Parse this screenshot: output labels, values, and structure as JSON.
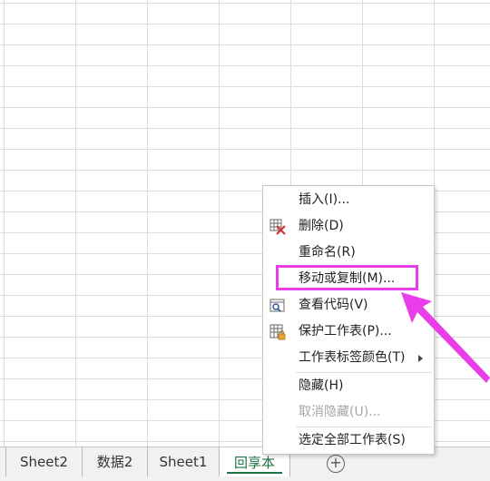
{
  "sheet_tabs": [
    {
      "label": "Sheet2",
      "active": false
    },
    {
      "label": "数据2",
      "active": false
    },
    {
      "label": "Sheet1",
      "active": false
    },
    {
      "label": "回享本",
      "active": true
    }
  ],
  "add_sheet_symbol": "+",
  "context_menu": {
    "items": [
      {
        "label": "插入(I)...",
        "icon": "none",
        "enabled": true
      },
      {
        "label": "删除(D)",
        "icon": "delete-sheet-icon",
        "enabled": true
      },
      {
        "label": "重命名(R)",
        "icon": "none",
        "enabled": true
      },
      {
        "label": "移动或复制(M)...",
        "icon": "none",
        "enabled": true,
        "highlighted": true
      },
      {
        "label": "查看代码(V)",
        "icon": "view-code-icon",
        "enabled": true
      },
      {
        "label": "保护工作表(P)...",
        "icon": "protect-sheet-icon",
        "enabled": true
      },
      {
        "label": "工作表标签颜色(T)",
        "icon": "none",
        "enabled": true,
        "submenu": true
      },
      {
        "label": "隐藏(H)",
        "icon": "none",
        "enabled": true
      },
      {
        "label": "取消隐藏(U)...",
        "icon": "none",
        "enabled": false
      },
      {
        "label": "选定全部工作表(S)",
        "icon": "none",
        "enabled": true
      }
    ]
  },
  "colors": {
    "annotation": "#e83de8",
    "active_tab_text": "#217346",
    "delete_x": "#d13438"
  }
}
